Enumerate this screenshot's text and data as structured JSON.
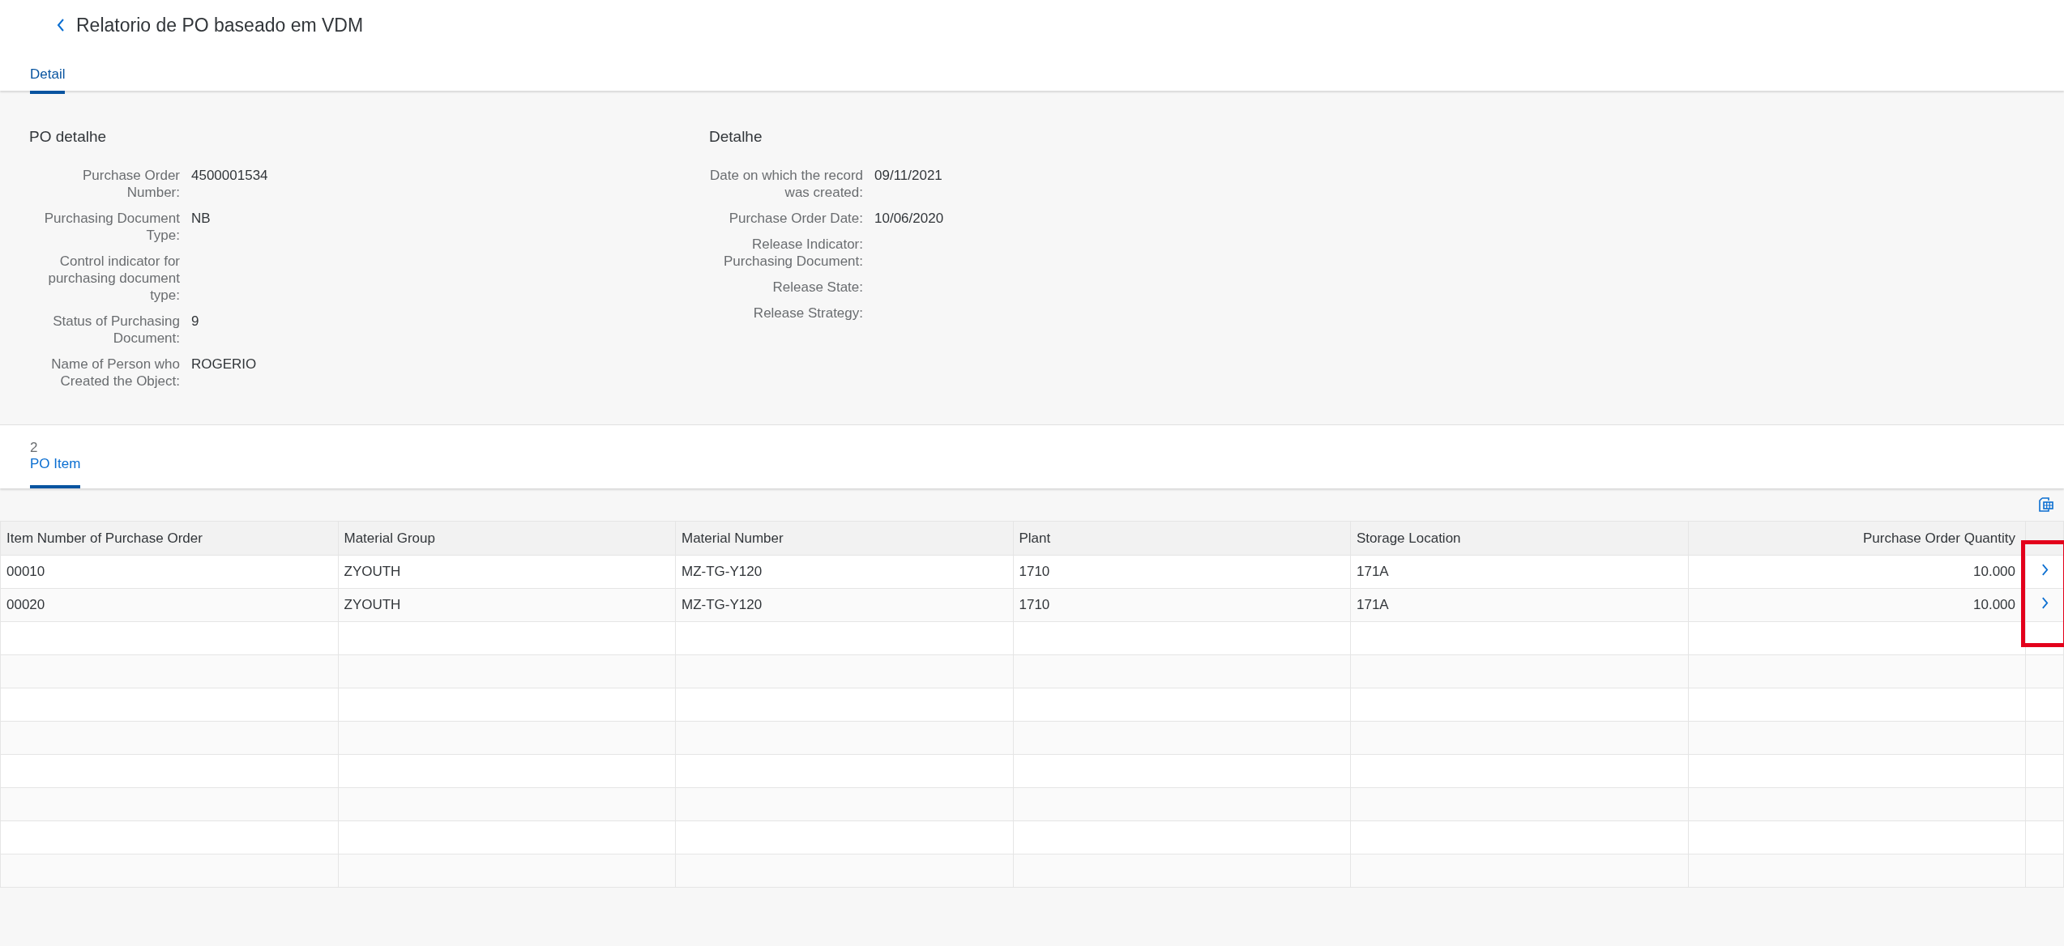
{
  "header": {
    "title": "Relatorio de PO baseado em VDM"
  },
  "tabs": [
    {
      "label": "Detail",
      "selected": true
    }
  ],
  "sections": [
    {
      "title": "PO detalhe",
      "fields": [
        {
          "label": "Purchase Order Number:",
          "value": "4500001534"
        },
        {
          "label": "Purchasing Document Type:",
          "value": "NB"
        },
        {
          "label": "Control indicator for purchasing document type:"
        },
        {
          "label": "Status of Purchasing Document:",
          "value": "9"
        },
        {
          "label": "Name of Person who Created the Object:",
          "value": "ROGERIO"
        }
      ]
    },
    {
      "title": "Detalhe",
      "fields": [
        {
          "label": "Date on which the record was created:",
          "value": "09/11/2021"
        },
        {
          "label": "Purchase Order Date:",
          "value": "10/06/2020"
        },
        {
          "label": "Release Indicator: Purchasing Document:"
        },
        {
          "label": "Release State:"
        },
        {
          "label": "Release Strategy:"
        }
      ]
    }
  ],
  "item_tabs": [
    {
      "count": "2",
      "label": "PO Item",
      "selected": true
    }
  ],
  "table": {
    "columns": [
      {
        "label": "Item Number of Purchase Order"
      },
      {
        "label": "Material Group"
      },
      {
        "label": "Material Number"
      },
      {
        "label": "Plant"
      },
      {
        "label": "Storage Location"
      },
      {
        "label": "Purchase Order Quantity"
      }
    ],
    "rows": [
      {
        "cells": [
          "00010",
          "ZYOUTH",
          "MZ-TG-Y120",
          "1710",
          "171A",
          "10.000"
        ]
      },
      {
        "cells": [
          "00020",
          "ZYOUTH",
          "MZ-TG-Y120",
          "1710",
          "171A",
          "10.000"
        ]
      }
    ]
  }
}
